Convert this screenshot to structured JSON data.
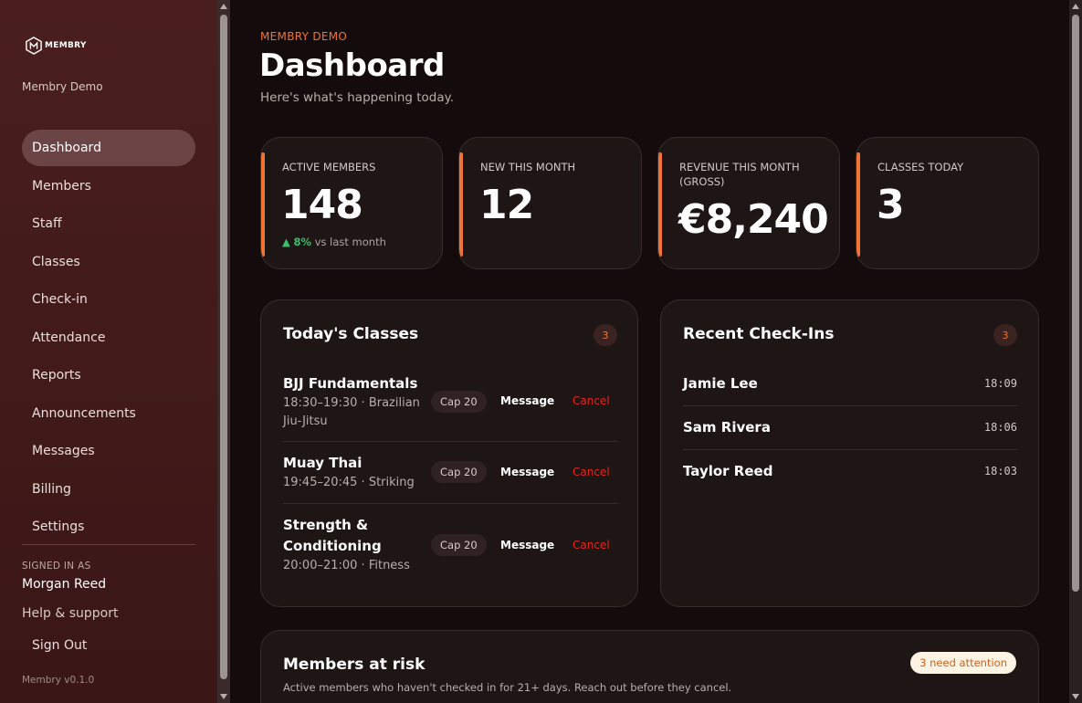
{
  "sidebar": {
    "logo_text": "MEMBRY",
    "org_name": "Membry Demo",
    "items": [
      {
        "label": "Dashboard",
        "active": true
      },
      {
        "label": "Members"
      },
      {
        "label": "Staff"
      },
      {
        "label": "Classes"
      },
      {
        "label": "Check-in"
      },
      {
        "label": "Attendance"
      },
      {
        "label": "Reports"
      },
      {
        "label": "Announcements"
      },
      {
        "label": "Messages"
      },
      {
        "label": "Billing"
      },
      {
        "label": "Settings"
      }
    ],
    "signed_in_label": "SIGNED IN AS",
    "signed_in_user": "Morgan Reed",
    "help_label": "Help & support",
    "sign_out_label": "Sign Out",
    "version": "Membry v0.1.0"
  },
  "header": {
    "eyebrow": "MEMBRY DEMO",
    "title": "Dashboard",
    "subtitle": "Here's what's happening today."
  },
  "stats": [
    {
      "label": "ACTIVE MEMBERS",
      "value": "148",
      "trend_value": "8%",
      "trend_text": "vs last month"
    },
    {
      "label": "NEW THIS MONTH",
      "value": "12"
    },
    {
      "label": "REVENUE THIS MONTH (GROSS)",
      "value": "€8,240"
    },
    {
      "label": "CLASSES TODAY",
      "value": "3"
    }
  ],
  "todays_classes": {
    "title": "Today's Classes",
    "count": "3",
    "rows": [
      {
        "name": "BJJ Fundamentals",
        "meta": "18:30–19:30 · Brazilian Jiu-Jitsu",
        "cap": "Cap 20",
        "message": "Message",
        "cancel": "Cancel"
      },
      {
        "name": "Muay Thai",
        "meta": "19:45–20:45 · Striking",
        "cap": "Cap 20",
        "message": "Message",
        "cancel": "Cancel"
      },
      {
        "name": "Strength & Conditioning",
        "meta": "20:00–21:00 · Fitness",
        "cap": "Cap 20",
        "message": "Message",
        "cancel": "Cancel"
      }
    ]
  },
  "recent_checkins": {
    "title": "Recent Check-Ins",
    "count": "3",
    "rows": [
      {
        "name": "Jamie Lee",
        "time": "18:09"
      },
      {
        "name": "Sam Rivera",
        "time": "18:06"
      },
      {
        "name": "Taylor Reed",
        "time": "18:03"
      }
    ]
  },
  "members_at_risk": {
    "title": "Members at risk",
    "subtitle": "Active members who haven't checked in for 21+ days. Reach out before they cancel.",
    "badge": "3 need attention"
  },
  "colors": {
    "accent": "#f07436",
    "sidebar_bg": "#4a1e1e",
    "main_bg": "#140c0c",
    "card_bg": "#1e1515",
    "danger": "#e8251f",
    "success": "#39c06a"
  }
}
